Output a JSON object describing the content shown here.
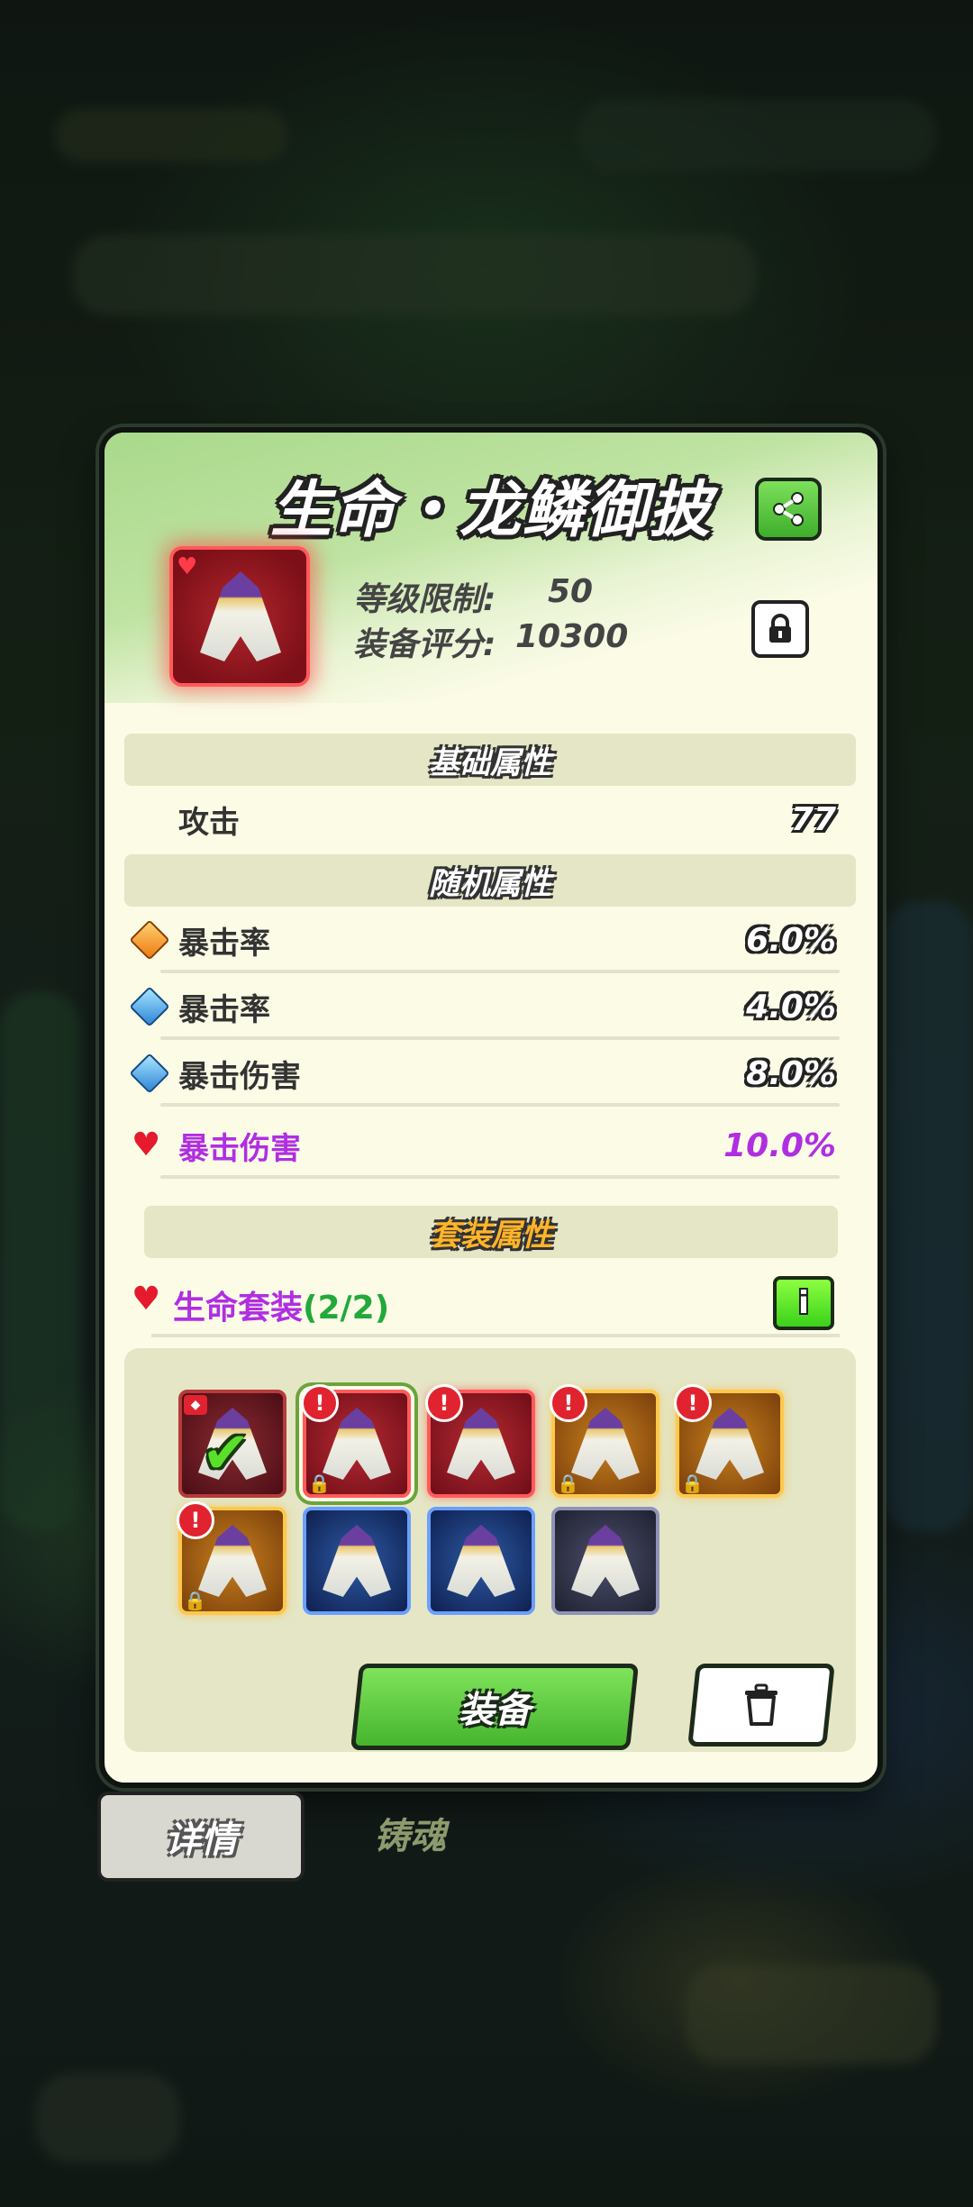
{
  "item": {
    "title": "生命・龙鳞御披",
    "level_label": "等级限制:",
    "level_value": "50",
    "score_label": "装备评分:",
    "score_value": "10300"
  },
  "sections": {
    "base": "基础属性",
    "random": "随机属性",
    "set": "套装属性"
  },
  "base_stats": [
    {
      "name": "攻击",
      "value": "77"
    }
  ],
  "random_stats": [
    {
      "icon": "orange-gem-icon",
      "name": "暴击率",
      "value": "6.0%"
    },
    {
      "icon": "blue-gem-icon",
      "name": "暴击率",
      "value": "4.0%"
    },
    {
      "icon": "blue-gem-icon",
      "name": "暴击伤害",
      "value": "8.0%"
    },
    {
      "icon": "heart-icon",
      "name": "暴击伤害",
      "value": "10.0%"
    }
  ],
  "set_bonus": {
    "name": "生命套装",
    "count": "(2/2)",
    "info_label": "i"
  },
  "buttons": {
    "equip": "装备"
  },
  "tabs": {
    "details": "详情",
    "forge": "铸魂"
  },
  "colors": {
    "accent_green": "#46b52e",
    "rarity_red": "#b72a32",
    "purple_text": "#b02ee2",
    "set_count_green": "#21a93a"
  }
}
